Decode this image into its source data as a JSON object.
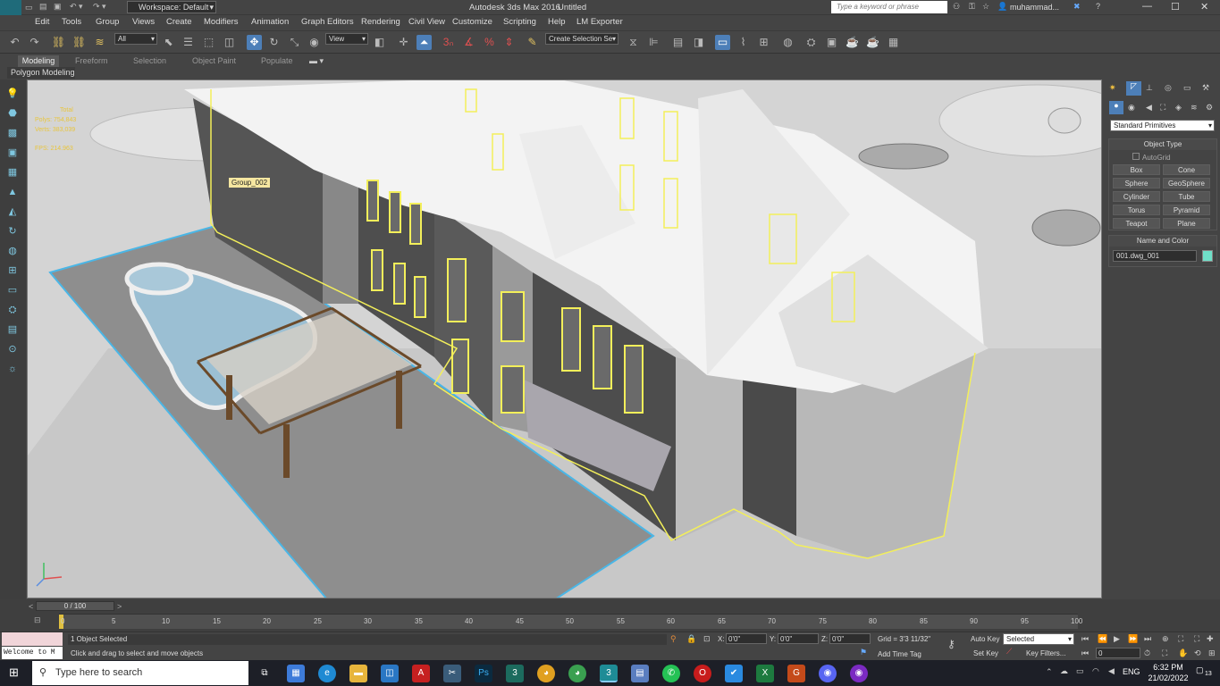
{
  "titlebar": {
    "workspace_label": "Workspace: Default",
    "title": "Autodesk 3ds Max 2016",
    "document": "Untitled",
    "search_placeholder": "Type a keyword or phrase",
    "user": "muhammad..."
  },
  "menu": [
    "Edit",
    "Tools",
    "Group",
    "Views",
    "Create",
    "Modifiers",
    "Animation",
    "Graph Editors",
    "Rendering",
    "Civil View",
    "Customize",
    "Scripting",
    "Help",
    "LM Exporter"
  ],
  "toolbar": {
    "selection_filter": "All",
    "ref_coord": "View",
    "named_selection": "Create Selection Se"
  },
  "ribbon": {
    "tabs": [
      "Modeling",
      "Freeform",
      "Selection",
      "Object Paint",
      "Populate"
    ],
    "active": "Modeling",
    "sub_label": "Polygon Modeling"
  },
  "viewport": {
    "stats": {
      "total_label": "Total",
      "polys_label": "Polys:",
      "polys_value": "754,843",
      "verts_label": "Verts:",
      "verts_value": "383,039",
      "fps_label": "FPS:",
      "fps_value": "214.963"
    },
    "tooltip": "Group_002"
  },
  "command_panel": {
    "primitive_type": "Standard Primitives",
    "object_type_header": "Object Type",
    "autogrid": "AutoGrid",
    "buttons": [
      "Box",
      "Cone",
      "Sphere",
      "GeoSphere",
      "Cylinder",
      "Tube",
      "Torus",
      "Pyramid",
      "Teapot",
      "Plane"
    ],
    "name_color_header": "Name and Color",
    "object_name": "001.dwg_001",
    "color": "#6fe0c8"
  },
  "timeline": {
    "frame_counter": "0 / 100",
    "ticks": [
      "0",
      "5",
      "10",
      "15",
      "20",
      "25",
      "30",
      "35",
      "40",
      "45",
      "50",
      "55",
      "60",
      "65",
      "70",
      "75",
      "80",
      "85",
      "90",
      "95",
      "100"
    ]
  },
  "status": {
    "listener": "Welcome to M",
    "selected": "1 Object Selected",
    "prompt": "Click and drag to select and move objects",
    "x_label": "X:",
    "x_value": "0'0\"",
    "y_label": "Y:",
    "y_value": "0'0\"",
    "z_label": "Z:",
    "z_value": "0'0\"",
    "grid": "Grid = 3'3 11/32\"",
    "add_time_tag": "Add Time Tag",
    "auto_key": "Auto Key",
    "set_key": "Set Key",
    "key_mode": "Selected",
    "key_filters": "Key Filters...",
    "frame_value": "0"
  },
  "taskbar": {
    "search_placeholder": "Type here to search",
    "lang": "ENG",
    "time": "6:32 PM",
    "date": "21/02/2022",
    "notif_count": "13"
  }
}
